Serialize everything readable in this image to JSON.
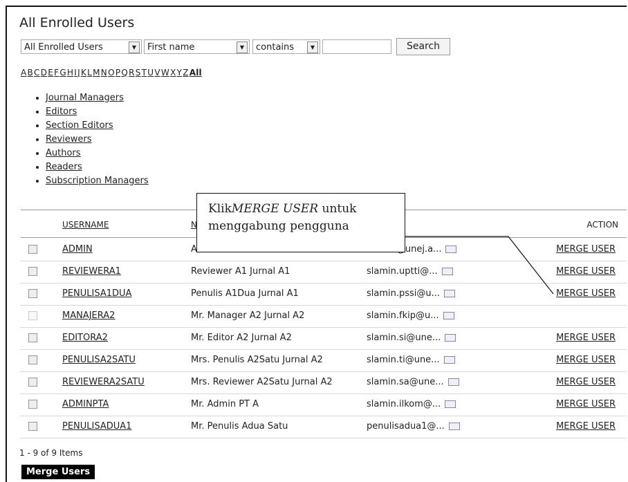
{
  "title": "All Enrolled Users",
  "filters": {
    "group": "All Enrolled Users",
    "field": "First name",
    "match": "contains",
    "query": "",
    "search_label": "Search"
  },
  "alphabet": [
    "A",
    "B",
    "C",
    "D",
    "E",
    "F",
    "G",
    "H",
    "I",
    "J",
    "K",
    "L",
    "M",
    "N",
    "O",
    "P",
    "Q",
    "R",
    "S",
    "T",
    "U",
    "V",
    "W",
    "X",
    "Y",
    "Z"
  ],
  "alphabet_all": "All",
  "roles": [
    "Journal Managers",
    "Editors",
    "Section Editors",
    "Reviewers",
    "Authors",
    "Readers",
    "Subscription Managers"
  ],
  "table": {
    "headers": {
      "username": "USERNAME",
      "name": "N",
      "action": "ACTION"
    },
    "rows": [
      {
        "username": "ADMIN",
        "name": "A",
        "email": "slamin@unej.a...",
        "action": "MERGE USER"
      },
      {
        "username": "REVIEWERA1",
        "name": "Reviewer A1 Jurnal A1",
        "email": "slamin.uptti@...",
        "action": "MERGE USER"
      },
      {
        "username": "PENULISA1DUA",
        "name": "Penulis A1Dua Jurnal A1",
        "email": "slamin.pssi@u...",
        "action": "MERGE USER"
      },
      {
        "username": "MANAJERA2",
        "name": "Mr. Manager A2 Jurnal A2",
        "email": "slamin.fkip@u...",
        "action": ""
      },
      {
        "username": "EDITORA2",
        "name": "Mr. Editor A2 Jurnal A2",
        "email": "slamin.si@une...",
        "action": "MERGE USER"
      },
      {
        "username": "PENULISA2SATU",
        "name": "Mrs. Penulis A2Satu Jurnal A2",
        "email": "slamin.ti@une...",
        "action": "MERGE USER"
      },
      {
        "username": "REVIEWERA2SATU",
        "name": "Mrs. Reviewer A2Satu Jurnal A2",
        "email": "slamin.sa@une...",
        "action": "MERGE USER"
      },
      {
        "username": "ADMINPTA",
        "name": "Mr. Admin PT A",
        "email": "slamin.ilkom@...",
        "action": "MERGE USER"
      },
      {
        "username": "PENULISADUA1",
        "name": "Mr. Penulis Adua Satu",
        "email": "penulisadua1@...",
        "action": "MERGE USER"
      }
    ]
  },
  "pagination": "1 - 9 of 9 Items",
  "merge_button": "Merge Users",
  "callout": {
    "prefix": "Klik",
    "emphasis": "MERGE USER",
    "suffix": " untuk",
    "line2": "menggabung pengguna"
  }
}
